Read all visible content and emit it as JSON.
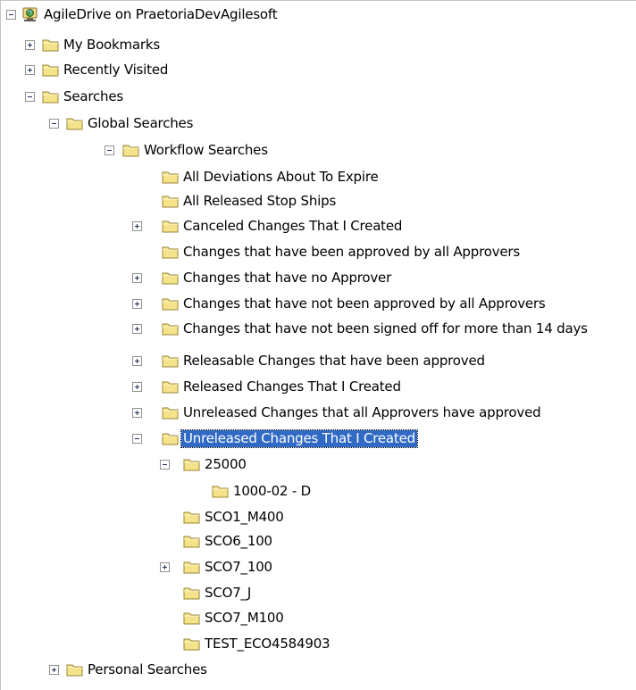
{
  "tree": {
    "root": {
      "label": "AgileDrive on PraetoriaDevAgilesoft",
      "icon": "server-globe-icon",
      "expanded": true
    },
    "nodes": [
      {
        "label": "My Bookmarks",
        "toggle": "plus"
      },
      {
        "label": "Recently Visited",
        "toggle": "plus"
      },
      {
        "label": "Searches",
        "toggle": "minus"
      },
      {
        "label": "Global Searches",
        "toggle": "minus"
      },
      {
        "label": "Workflow Searches",
        "toggle": "minus"
      },
      {
        "label": "All Deviations About To Expire",
        "toggle": "none"
      },
      {
        "label": "All Released Stop Ships",
        "toggle": "none"
      },
      {
        "label": "Canceled Changes That I Created",
        "toggle": "plus"
      },
      {
        "label": "Changes that have been approved by all Approvers",
        "toggle": "none"
      },
      {
        "label": "Changes that have no Approver",
        "toggle": "plus"
      },
      {
        "label": "Changes that have not been approved by all Approvers",
        "toggle": "plus"
      },
      {
        "label": "Changes that have not been signed off for more than 14 days",
        "toggle": "plus"
      },
      {
        "label": "Releasable Changes that have been approved",
        "toggle": "plus"
      },
      {
        "label": "Released Changes That I Created",
        "toggle": "plus"
      },
      {
        "label": "Unreleased Changes that all Approvers have approved",
        "toggle": "plus"
      },
      {
        "label": "Unreleased Changes That I Created",
        "toggle": "minus",
        "selected": true
      },
      {
        "label": "25000",
        "toggle": "minus"
      },
      {
        "label": "1000-02 - D",
        "toggle": "none"
      },
      {
        "label": "SCO1_M400",
        "toggle": "none"
      },
      {
        "label": "SCO6_100",
        "toggle": "none"
      },
      {
        "label": "SCO7_100",
        "toggle": "plus"
      },
      {
        "label": "SCO7_J",
        "toggle": "none"
      },
      {
        "label": "SCO7_M100",
        "toggle": "none"
      },
      {
        "label": "TEST_ECO4584903",
        "toggle": "none"
      },
      {
        "label": "Personal Searches",
        "toggle": "plus"
      }
    ]
  },
  "colors": {
    "selection": "#316ac5",
    "folder_fill": "#f4e38a",
    "folder_stroke": "#9a8436",
    "toggle_border": "#919191"
  }
}
